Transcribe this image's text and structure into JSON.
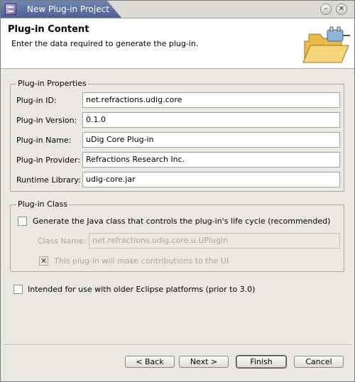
{
  "window": {
    "title": "New Plug-in Project"
  },
  "titlebar_buttons": {
    "minimize_glyph": "–",
    "close_glyph": "✕"
  },
  "header": {
    "title": "Plug-in Content",
    "description": "Enter the data required to generate the plug-in.",
    "icon": "folder-plugin-icon"
  },
  "properties": {
    "legend": "Plug-in Properties",
    "fields": [
      {
        "label": "Plug-in ID:",
        "value": "net.refractions.udig.core"
      },
      {
        "label": "Plug-in Version:",
        "value": "0.1.0"
      },
      {
        "label": "Plug-in Name:",
        "value": "uDig Core Plug-in"
      },
      {
        "label": "Plug-in Provider:",
        "value": "Refractions Research Inc."
      },
      {
        "label": "Runtime Library:",
        "value": "udig-core.jar"
      }
    ]
  },
  "plugin_class": {
    "legend": "Plug-in Class",
    "generate_label": "Generate the Java class that controls the plug-in's life cycle (recommended)",
    "generate_checked": false,
    "class_name_label": "Class Name:",
    "class_name_value": "net.refractions.udig.core.u.UPlugin",
    "ui_contrib_label": "This plug-in will make contributions to the UI",
    "ui_contrib_glyph": "✕",
    "ui_contrib_checked": true
  },
  "legacy": {
    "label": "Intended for use with older Eclipse platforms (prior to 3.0)",
    "checked": false
  },
  "buttons": {
    "back": "< Back",
    "next": "Next >",
    "finish": "Finish",
    "cancel": "Cancel"
  }
}
